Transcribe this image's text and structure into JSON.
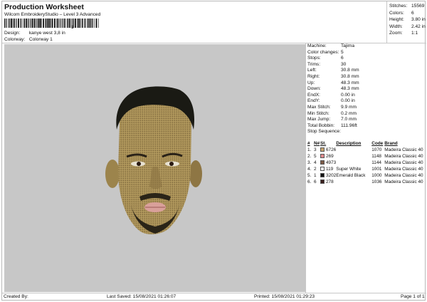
{
  "header": {
    "title": "Production Worksheet",
    "subtitle": "Wilcom EmbroideryStudio – Level 3 Advanced",
    "barcode_number": "1"
  },
  "design_meta": [
    {
      "label": "Design:",
      "value": "kanye west 3,8 in"
    },
    {
      "label": "Colorway:",
      "value": "Colorway 1"
    }
  ],
  "stats": [
    {
      "label": "Stitches:",
      "value": "15569"
    },
    {
      "label": "Colors:",
      "value": "6"
    },
    {
      "label": "Height:",
      "value": "3.80 in"
    },
    {
      "label": "Width:",
      "value": "2.42 in"
    },
    {
      "label": "Zoom:",
      "value": "1:1"
    }
  ],
  "machine_info": [
    {
      "label": "Machine:",
      "value": "Tajima"
    },
    {
      "label": "Color changes:",
      "value": "5"
    },
    {
      "label": "Stops:",
      "value": "6"
    },
    {
      "label": "Trims:",
      "value": "30"
    },
    {
      "label": "Left:",
      "value": "30.8 mm"
    },
    {
      "label": "Right:",
      "value": "30.8 mm"
    },
    {
      "label": "Up:",
      "value": "48.3 mm"
    },
    {
      "label": "Down:",
      "value": "48.3 mm"
    },
    {
      "label": "EndX:",
      "value": "0.00 in"
    },
    {
      "label": "EndY:",
      "value": "0.00 in"
    },
    {
      "label": "Max Stitch:",
      "value": "9.9 mm"
    },
    {
      "label": "Min Stitch:",
      "value": "0.2 mm"
    },
    {
      "label": "Max Jump:",
      "value": "7.0 mm"
    },
    {
      "label": "Total Bobbin:",
      "value": "111.96ft"
    }
  ],
  "stop_sequence": {
    "title": "Stop Sequence:",
    "columns": [
      "#",
      "N#",
      "St.",
      "Description",
      "Code",
      "Brand"
    ],
    "rows": [
      {
        "num": "1.",
        "n": "3",
        "color": "#c8a46e",
        "st": "6726",
        "desc": "",
        "code": "1070",
        "brand": "Madeira Classic 40"
      },
      {
        "num": "2.",
        "n": "5",
        "color": "#e08a8e",
        "st": "269",
        "desc": "",
        "code": "1148",
        "brand": "Madeira Classic 40"
      },
      {
        "num": "3.",
        "n": "4",
        "color": "#7c5a47",
        "st": "4973",
        "desc": "",
        "code": "1144",
        "brand": "Madeira Classic 40"
      },
      {
        "num": "4.",
        "n": "2",
        "color": "#f2f2f2",
        "st": "119",
        "desc": "Super White",
        "code": "1001",
        "brand": "Madeira Classic 40"
      },
      {
        "num": "5.",
        "n": "1",
        "color": "#111111",
        "st": "3202",
        "desc": "Emerald Black",
        "code": "1000",
        "brand": "Madeira Classic 40"
      },
      {
        "num": "6.",
        "n": "6",
        "color": "#3a1f1c",
        "st": "278",
        "desc": "",
        "code": "1036",
        "brand": "Madeira Classic 40"
      }
    ]
  },
  "footer": {
    "created_by": "Created By:",
    "last_saved": "Last Saved: 15/08/2021 01:26:07",
    "printed": "Printed: 15/08/2021 01:29:23",
    "page": "Page 1 of 1"
  },
  "colors": {
    "canvas_bg": "#c7c7c7",
    "skin": "#b39a5e",
    "hair": "#1a1a14",
    "lips": "#d9a09a"
  }
}
